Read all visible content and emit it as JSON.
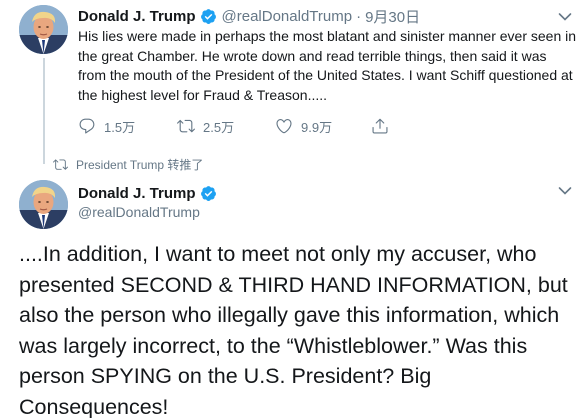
{
  "tweet": {
    "author_name": "Donald J. Trump",
    "author_handle": "@realDonaldTrump",
    "separator": "·",
    "time": "9月30日",
    "text": "His lies were made in perhaps the most blatant and sinister manner ever seen in the great Chamber. He wrote down and read terrible things, then said it was from the mouth of the President of the United States. I want Schiff questioned at the highest level for Fraud & Treason.....",
    "actions": {
      "replies": "1.5万",
      "retweets": "2.5万",
      "likes": "9.9万"
    }
  },
  "retweet_context": {
    "label": "President Trump 转推了"
  },
  "retweeted_tweet": {
    "author_name": "Donald J. Trump",
    "author_handle": "@realDonaldTrump",
    "text": "....In addition, I want to meet not only my accuser, who presented SECOND & THIRD HAND INFORMATION, but also the person who illegally gave this information, which was largely incorrect, to the “Whistleblower.” Was this person SPYING on the U.S. President? Big Consequences!"
  },
  "colors": {
    "text_primary": "#14171a",
    "text_secondary": "#657786",
    "verified_blue": "#1da1f2",
    "thread_line": "#ccd6dd"
  },
  "icons": {
    "verified": "verified-badge-icon",
    "reply": "reply-icon",
    "retweet": "retweet-icon",
    "like": "heart-icon",
    "share": "share-icon",
    "more": "chevron-down-icon"
  }
}
